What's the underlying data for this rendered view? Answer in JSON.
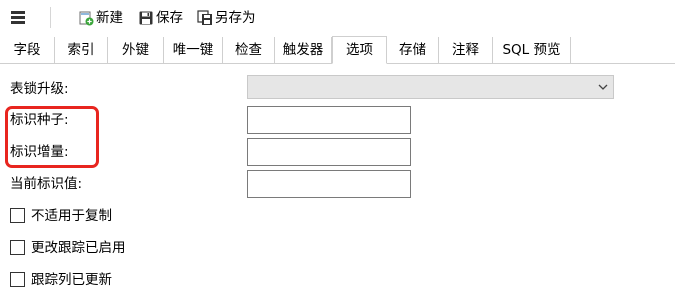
{
  "toolbar": {
    "menu_icon": "hamburger-menu-icon",
    "new_label": "新建",
    "new_icon": "new-document-plus-icon",
    "save_label": "保存",
    "save_icon": "floppy-disk-icon",
    "save_as_label": "另存为",
    "save_as_icon": "save-as-icon"
  },
  "tabs": [
    {
      "label": "字段"
    },
    {
      "label": "索引"
    },
    {
      "label": "外键"
    },
    {
      "label": "唯一键"
    },
    {
      "label": "检查"
    },
    {
      "label": "触发器"
    },
    {
      "label": "选项",
      "active": true
    },
    {
      "label": "存储"
    },
    {
      "label": "注释"
    },
    {
      "label": "SQL 预览"
    }
  ],
  "options": {
    "lock_escalation_label": "表锁升级:",
    "lock_escalation_value": "",
    "identity_seed_label": "标识种子:",
    "identity_seed_value": "",
    "identity_increment_label": "标识增量:",
    "identity_increment_value": "",
    "current_identity_label": "当前标识值:",
    "current_identity_value": "",
    "checkboxes": [
      {
        "label": "不适用于复制",
        "checked": false
      },
      {
        "label": "更改跟踪已启用",
        "checked": false
      },
      {
        "label": "跟踪列已更新",
        "checked": false
      }
    ]
  },
  "colors": {
    "highlight_border": "#e8251f",
    "new_icon_green": "#3aa53a",
    "icon_dark": "#333333"
  }
}
